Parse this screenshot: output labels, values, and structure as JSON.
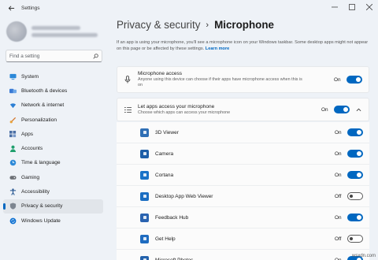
{
  "window": {
    "title": "Settings"
  },
  "search": {
    "placeholder": "Find a setting"
  },
  "sidebar": {
    "items": [
      {
        "label": "System",
        "icon": "monitor-icon"
      },
      {
        "label": "Bluetooth & devices",
        "icon": "bluetooth-icon"
      },
      {
        "label": "Network & internet",
        "icon": "wifi-icon"
      },
      {
        "label": "Personalization",
        "icon": "brush-icon"
      },
      {
        "label": "Apps",
        "icon": "apps-icon"
      },
      {
        "label": "Accounts",
        "icon": "person-icon"
      },
      {
        "label": "Time & language",
        "icon": "clock-globe-icon"
      },
      {
        "label": "Gaming",
        "icon": "gamepad-icon"
      },
      {
        "label": "Accessibility",
        "icon": "accessibility-icon"
      },
      {
        "label": "Privacy & security",
        "icon": "shield-icon",
        "selected": true
      },
      {
        "label": "Windows Update",
        "icon": "update-icon"
      }
    ]
  },
  "header": {
    "parent": "Privacy & security",
    "separator": "›",
    "current": "Microphone"
  },
  "description": {
    "text": "If an app is using your microphone, you'll see a microphone icon on your Windows taskbar. Some desktop apps might not appear on this page or be affected by these settings.",
    "link": "Learn more"
  },
  "mic_access": {
    "title": "Microphone access",
    "subtitle": "Anyone using this device can choose if their apps have microphone access when this is on",
    "state": "On"
  },
  "apps_access": {
    "title": "Let apps access your microphone",
    "subtitle": "Choose which apps can access your microphone",
    "state": "On"
  },
  "apps": [
    {
      "name": "3D Viewer",
      "state": "On",
      "icon_color": "#2f6fb5"
    },
    {
      "name": "Camera",
      "state": "On",
      "icon_color": "#1e5fa8"
    },
    {
      "name": "Cortana",
      "state": "On",
      "icon_color": "#1a73c8"
    },
    {
      "name": "Desktop App Web Viewer",
      "state": "Off",
      "icon_color": "#1b6ec2"
    },
    {
      "name": "Feedback Hub",
      "state": "On",
      "icon_color": "#2a63b0"
    },
    {
      "name": "Get Help",
      "state": "Off",
      "icon_color": "#1f6cc0"
    },
    {
      "name": "Microsoft Photos",
      "state": "On",
      "icon_color": "#2563ad"
    }
  ],
  "accent": "#0067c0",
  "watermark": "wsxdn.com"
}
